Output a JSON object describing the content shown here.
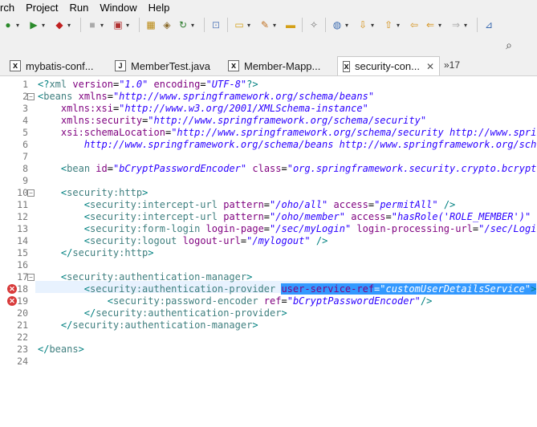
{
  "menubar": {
    "items": [
      "rch",
      "Project",
      "Run",
      "Window",
      "Help"
    ]
  },
  "tabs": [
    {
      "label": "mybatis-conf...",
      "icon": "xml-file-icon",
      "active": false
    },
    {
      "label": "MemberTest.java",
      "icon": "java-file-icon",
      "active": false
    },
    {
      "label": "Member-Mapp...",
      "icon": "xml-file-icon",
      "active": false
    },
    {
      "label": "security-con...",
      "icon": "xml-file-icon",
      "active": true
    }
  ],
  "tab_overflow": "»17",
  "editor": {
    "lines": [
      {
        "n": "1",
        "tokens": [
          [
            "pun",
            "<?"
          ],
          [
            "tag",
            "xml"
          ],
          [
            "plain",
            " "
          ],
          [
            "attr",
            "version"
          ],
          [
            "plain",
            "="
          ],
          [
            "str",
            "\"1.0\""
          ],
          [
            "plain",
            " "
          ],
          [
            "attr",
            "encoding"
          ],
          [
            "plain",
            "="
          ],
          [
            "str",
            "\"UTF-8\""
          ],
          [
            "pun",
            "?>"
          ]
        ]
      },
      {
        "n": "2",
        "fold": true,
        "tokens": [
          [
            "pun",
            "<"
          ],
          [
            "tag",
            "beans"
          ],
          [
            "plain",
            " "
          ],
          [
            "attr",
            "xmlns"
          ],
          [
            "plain",
            "="
          ],
          [
            "str",
            "\"http://www.springframework.org/schema/beans\""
          ]
        ]
      },
      {
        "n": "3",
        "tokens": [
          [
            "plain",
            "    "
          ],
          [
            "attr",
            "xmlns:xsi"
          ],
          [
            "plain",
            "="
          ],
          [
            "str",
            "\"http://www.w3.org/2001/XMLSchema-instance\""
          ]
        ]
      },
      {
        "n": "4",
        "tokens": [
          [
            "plain",
            "    "
          ],
          [
            "attr",
            "xmlns:security"
          ],
          [
            "plain",
            "="
          ],
          [
            "str",
            "\"http://www.springframework.org/schema/security\""
          ]
        ]
      },
      {
        "n": "5",
        "tokens": [
          [
            "plain",
            "    "
          ],
          [
            "attr",
            "xsi:schemaLocation"
          ],
          [
            "plain",
            "="
          ],
          [
            "str",
            "\"http://www.springframework.org/schema/security http://www.spring"
          ]
        ]
      },
      {
        "n": "6",
        "tokens": [
          [
            "plain",
            "        "
          ],
          [
            "str",
            "http://www.springframework.org/schema/beans http://www.springframework.org/schem"
          ]
        ]
      },
      {
        "n": "7",
        "tokens": []
      },
      {
        "n": "8",
        "tokens": [
          [
            "plain",
            "    "
          ],
          [
            "pun",
            "<"
          ],
          [
            "tag",
            "bean"
          ],
          [
            "plain",
            " "
          ],
          [
            "attr",
            "id"
          ],
          [
            "plain",
            "="
          ],
          [
            "str",
            "\"bCryptPasswordEncoder\""
          ],
          [
            "plain",
            " "
          ],
          [
            "attr",
            "class"
          ],
          [
            "plain",
            "="
          ],
          [
            "str",
            "\"org.springframework.security.crypto.bcrypt.B"
          ]
        ]
      },
      {
        "n": "9",
        "tokens": []
      },
      {
        "n": "10",
        "fold": true,
        "tokens": [
          [
            "plain",
            "    "
          ],
          [
            "pun",
            "<"
          ],
          [
            "tag",
            "security:http"
          ],
          [
            "pun",
            ">"
          ]
        ]
      },
      {
        "n": "11",
        "tokens": [
          [
            "plain",
            "        "
          ],
          [
            "pun",
            "<"
          ],
          [
            "tag",
            "security:intercept-url"
          ],
          [
            "plain",
            " "
          ],
          [
            "attr",
            "pattern"
          ],
          [
            "plain",
            "="
          ],
          [
            "str",
            "\"/oho/all\""
          ],
          [
            "plain",
            " "
          ],
          [
            "attr",
            "access"
          ],
          [
            "plain",
            "="
          ],
          [
            "str",
            "\"permitAll\""
          ],
          [
            "plain",
            " "
          ],
          [
            "pun",
            "/>"
          ]
        ]
      },
      {
        "n": "12",
        "tokens": [
          [
            "plain",
            "        "
          ],
          [
            "pun",
            "<"
          ],
          [
            "tag",
            "security:intercept-url"
          ],
          [
            "plain",
            " "
          ],
          [
            "attr",
            "pattern"
          ],
          [
            "plain",
            "="
          ],
          [
            "str",
            "\"/oho/member\""
          ],
          [
            "plain",
            " "
          ],
          [
            "attr",
            "access"
          ],
          [
            "plain",
            "="
          ],
          [
            "str",
            "\"hasRole('ROLE_MEMBER')\""
          ],
          [
            "plain",
            " "
          ],
          [
            "pun",
            "/>"
          ]
        ]
      },
      {
        "n": "13",
        "tokens": [
          [
            "plain",
            "        "
          ],
          [
            "pun",
            "<"
          ],
          [
            "tag",
            "security:form-login"
          ],
          [
            "plain",
            " "
          ],
          [
            "attr",
            "login-page"
          ],
          [
            "plain",
            "="
          ],
          [
            "str",
            "\"/sec/myLogin\""
          ],
          [
            "plain",
            " "
          ],
          [
            "attr",
            "login-processing-url"
          ],
          [
            "plain",
            "="
          ],
          [
            "str",
            "\"/sec/Login\""
          ]
        ]
      },
      {
        "n": "14",
        "tokens": [
          [
            "plain",
            "        "
          ],
          [
            "pun",
            "<"
          ],
          [
            "tag",
            "security:logout"
          ],
          [
            "plain",
            " "
          ],
          [
            "attr",
            "logout-url"
          ],
          [
            "plain",
            "="
          ],
          [
            "str",
            "\"/mylogout\""
          ],
          [
            "plain",
            " "
          ],
          [
            "pun",
            "/>"
          ]
        ]
      },
      {
        "n": "15",
        "tokens": [
          [
            "plain",
            "    "
          ],
          [
            "pun",
            "</"
          ],
          [
            "tag",
            "security:http"
          ],
          [
            "pun",
            ">"
          ]
        ]
      },
      {
        "n": "16",
        "tokens": []
      },
      {
        "n": "17",
        "fold": true,
        "tokens": [
          [
            "plain",
            "    "
          ],
          [
            "pun",
            "<"
          ],
          [
            "tag",
            "security:authentication-manager"
          ],
          [
            "pun",
            ">"
          ]
        ]
      },
      {
        "n": "18",
        "error": true,
        "current": true,
        "tokens": [
          [
            "plain",
            "        "
          ],
          [
            "pun",
            "<"
          ],
          [
            "tag",
            "security:authentication-provider"
          ],
          [
            "plain",
            " "
          ],
          [
            "sel_attr",
            "user-service-ref"
          ],
          [
            "sel_plain",
            "="
          ],
          [
            "sel_str",
            "\"customUserDetailsService\""
          ],
          [
            "sel_pun",
            ">"
          ]
        ]
      },
      {
        "n": "19",
        "error": true,
        "tokens": [
          [
            "plain",
            "            "
          ],
          [
            "pun",
            "<"
          ],
          [
            "tag",
            "security:password-encoder"
          ],
          [
            "plain",
            " "
          ],
          [
            "attr",
            "ref"
          ],
          [
            "plain",
            "="
          ],
          [
            "str",
            "\"bCryptPasswordEncoder\""
          ],
          [
            "pun",
            "/>"
          ]
        ]
      },
      {
        "n": "20",
        "tokens": [
          [
            "plain",
            "        "
          ],
          [
            "pun",
            "</"
          ],
          [
            "tag",
            "security:authentication-provider"
          ],
          [
            "pun",
            ">"
          ]
        ]
      },
      {
        "n": "21",
        "tokens": [
          [
            "plain",
            "    "
          ],
          [
            "pun",
            "</"
          ],
          [
            "tag",
            "security:authentication-manager"
          ],
          [
            "pun",
            ">"
          ]
        ]
      },
      {
        "n": "22",
        "tokens": []
      },
      {
        "n": "23",
        "tokens": [
          [
            "pun",
            "</"
          ],
          [
            "tag",
            "beans"
          ],
          [
            "pun",
            ">"
          ]
        ]
      },
      {
        "n": "24",
        "tokens": []
      }
    ]
  },
  "colors": {
    "tag": "#3f7f7f",
    "attribute": "#7f007f",
    "string": "#2a00ff",
    "selection": "#3399ff",
    "current_line": "#e8f2fe",
    "error": "#d83a3a"
  }
}
